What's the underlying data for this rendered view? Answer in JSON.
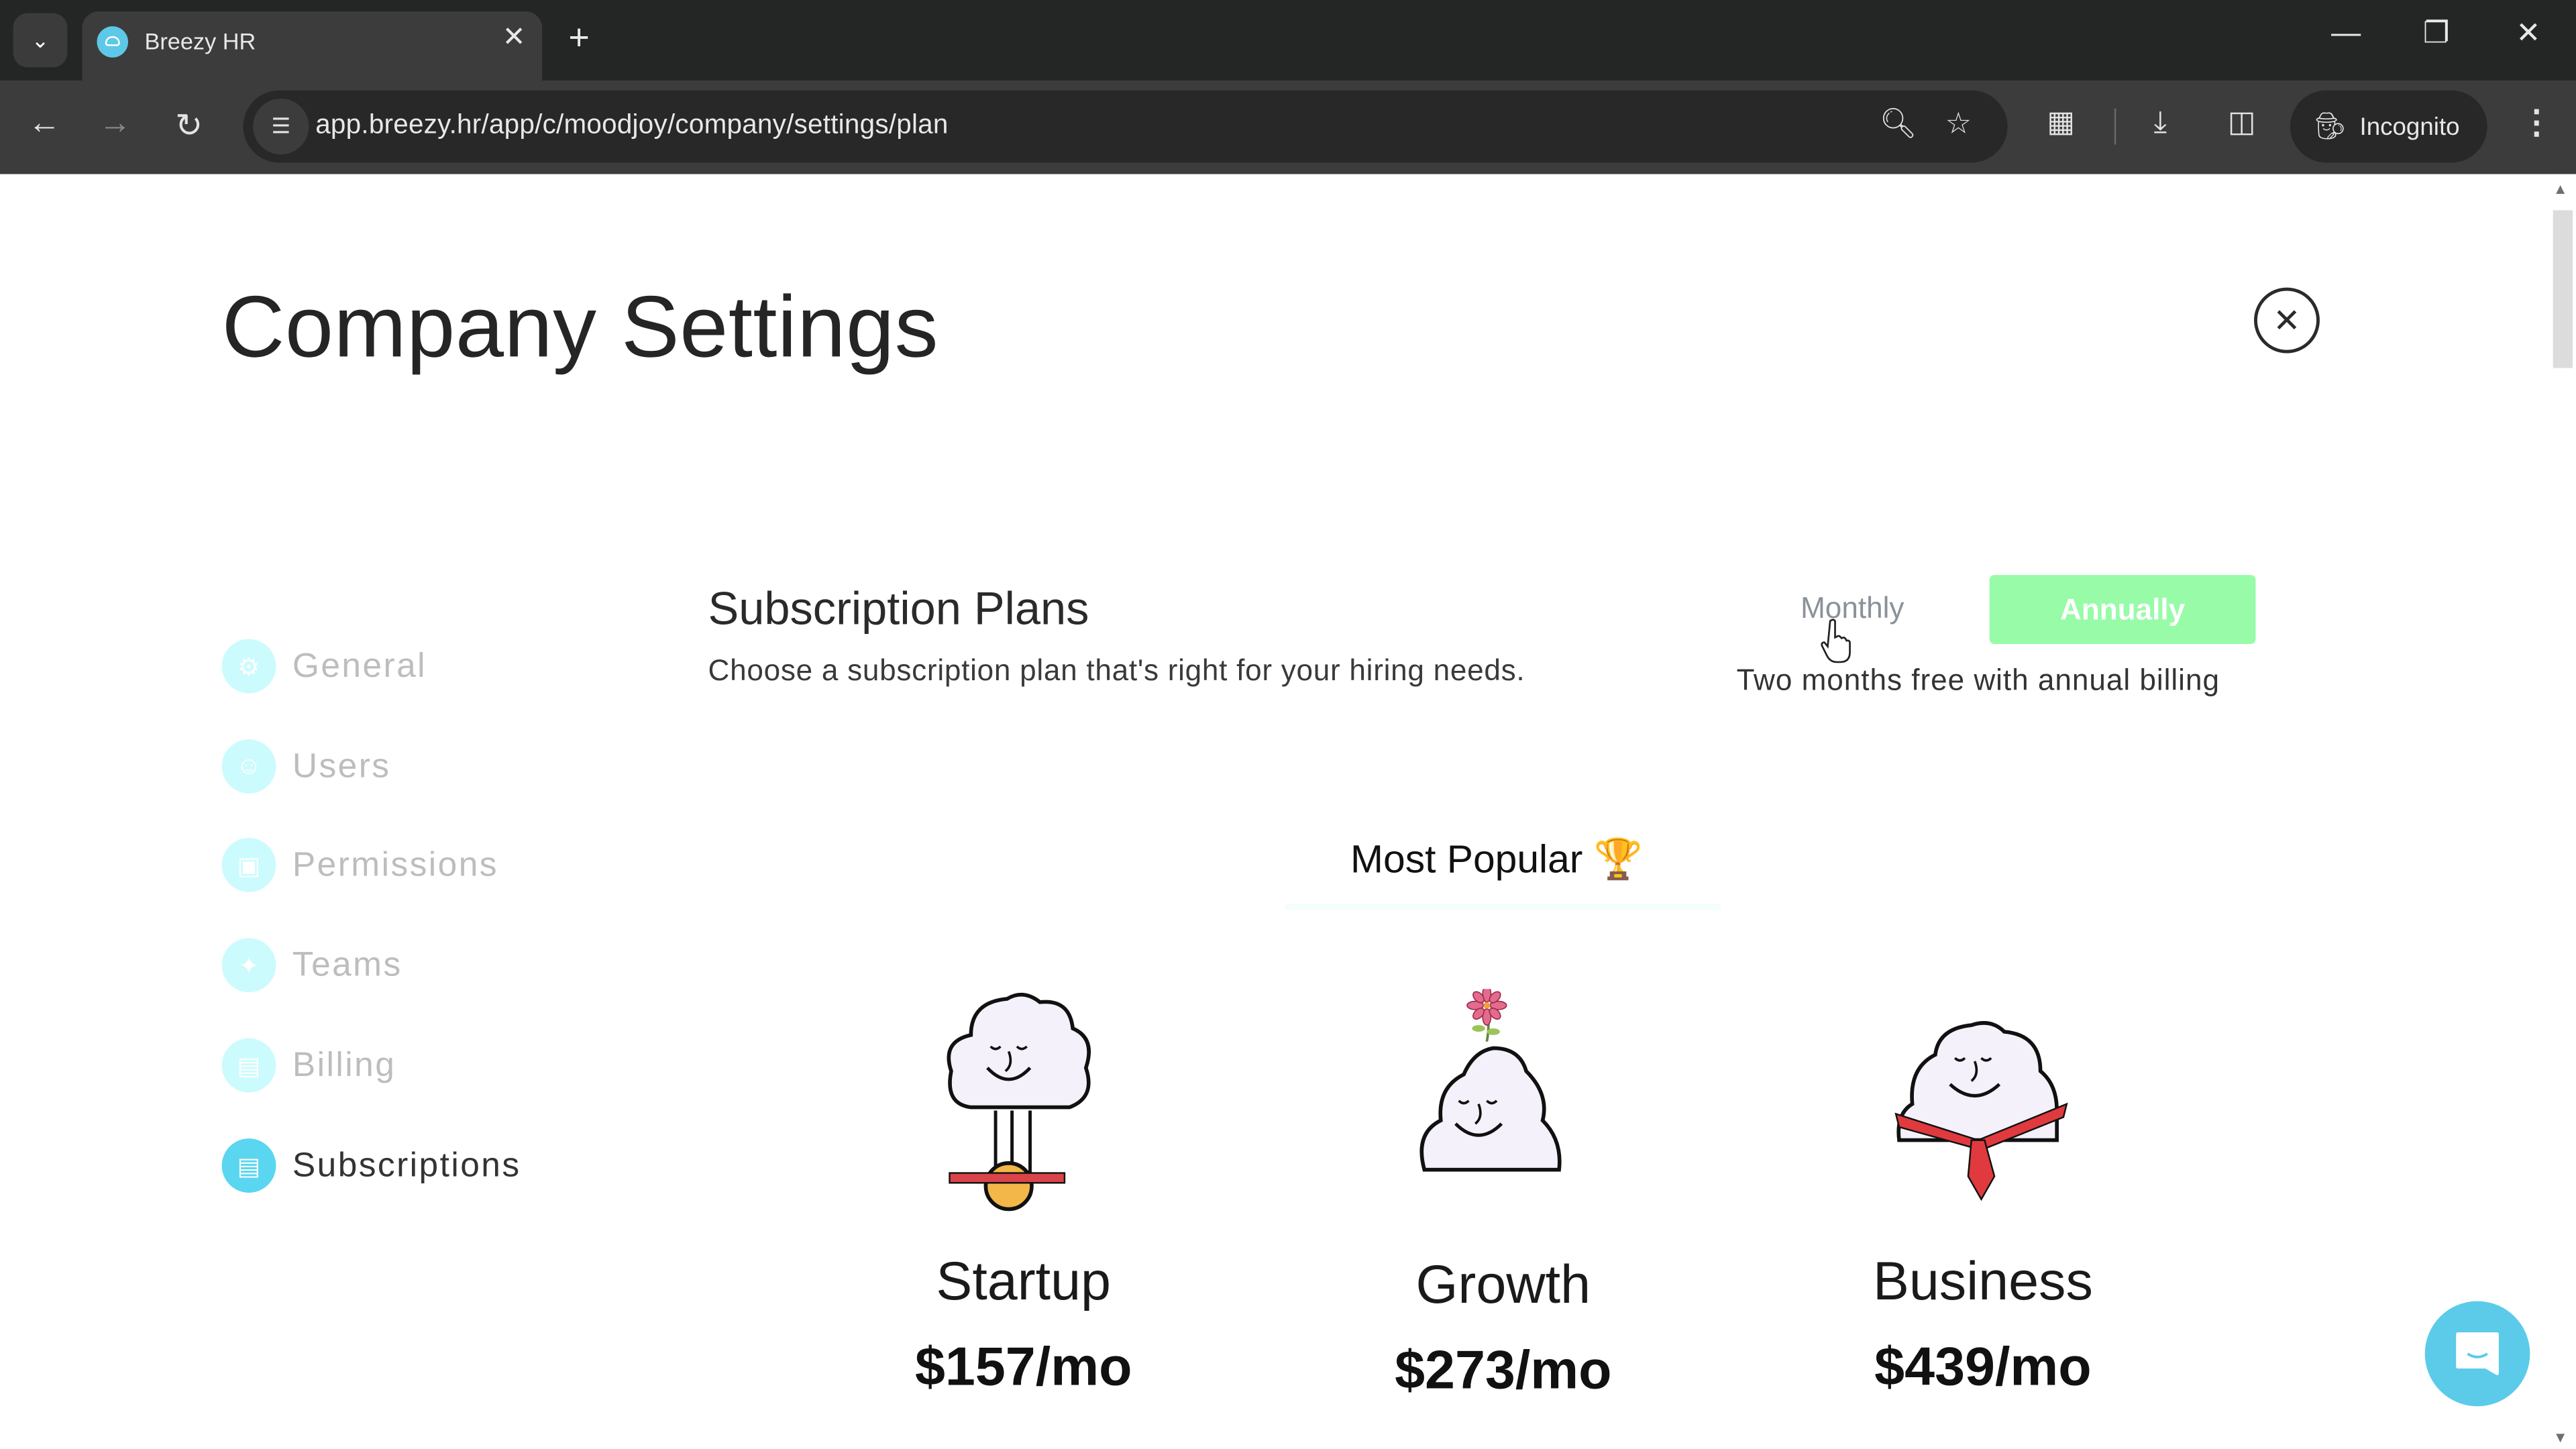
{
  "browser": {
    "tab_title": "Breezy HR",
    "url": "app.breezy.hr/app/c/moodjoy/company/settings/plan",
    "profile_label": "Incognito",
    "icons": {
      "tab_search": "chevron-down-icon",
      "favicon": "breezy-cloud-icon",
      "tab_close": "close-icon",
      "new_tab": "plus-icon",
      "back": "arrow-left-icon",
      "forward": "arrow-right-icon",
      "reload": "reload-icon",
      "site_info": "tune-icon",
      "zoom": "zoom-icon",
      "bookmark": "star-icon",
      "extensions": "puzzle-icon",
      "downloads": "download-icon",
      "side_panel": "side-panel-icon",
      "incognito": "incognito-icon",
      "menu": "kebab-menu-icon",
      "minimize": "minimize-icon",
      "restore": "restore-icon",
      "close_window": "close-icon"
    }
  },
  "page": {
    "title": "Company Settings",
    "close_icon": "close-circle-icon"
  },
  "sidebar": {
    "items": [
      {
        "label": "General",
        "icon": "gear-icon",
        "active": false
      },
      {
        "label": "Users",
        "icon": "user-icon",
        "active": false
      },
      {
        "label": "Permissions",
        "icon": "lock-icon",
        "active": false
      },
      {
        "label": "Teams",
        "icon": "team-icon",
        "active": false
      },
      {
        "label": "Billing",
        "icon": "credit-card-icon",
        "active": false
      },
      {
        "label": "Subscriptions",
        "icon": "list-icon",
        "active": true
      }
    ]
  },
  "subscriptions": {
    "title": "Subscription Plans",
    "subtitle": "Choose a subscription plan that's right for your hiring needs.",
    "billing_toggle": {
      "monthly_label": "Monthly",
      "annually_label": "Annually",
      "selected": "Annually",
      "note": "Two months free with annual billing"
    },
    "most_popular_label": "Most Popular",
    "most_popular_icon": "🏆",
    "plans": [
      {
        "name": "Startup",
        "price": "$157/mo",
        "illustration": "cloud-unicycle-illustration"
      },
      {
        "name": "Growth",
        "price": "$273/mo",
        "illustration": "cloud-flower-illustration",
        "most_popular": true
      },
      {
        "name": "Business",
        "price": "$439/mo",
        "illustration": "cloud-necktie-illustration"
      }
    ]
  },
  "colors": {
    "accent_cyan": "#5ad6f0",
    "accent_cyan_light": "#ccfbfd",
    "annual_button": "#98fba8",
    "chrome_dark": "#242625",
    "chrome_toolbar": "#3c3c3c"
  },
  "chat_widget": {
    "icon": "chat-bubble-icon"
  }
}
